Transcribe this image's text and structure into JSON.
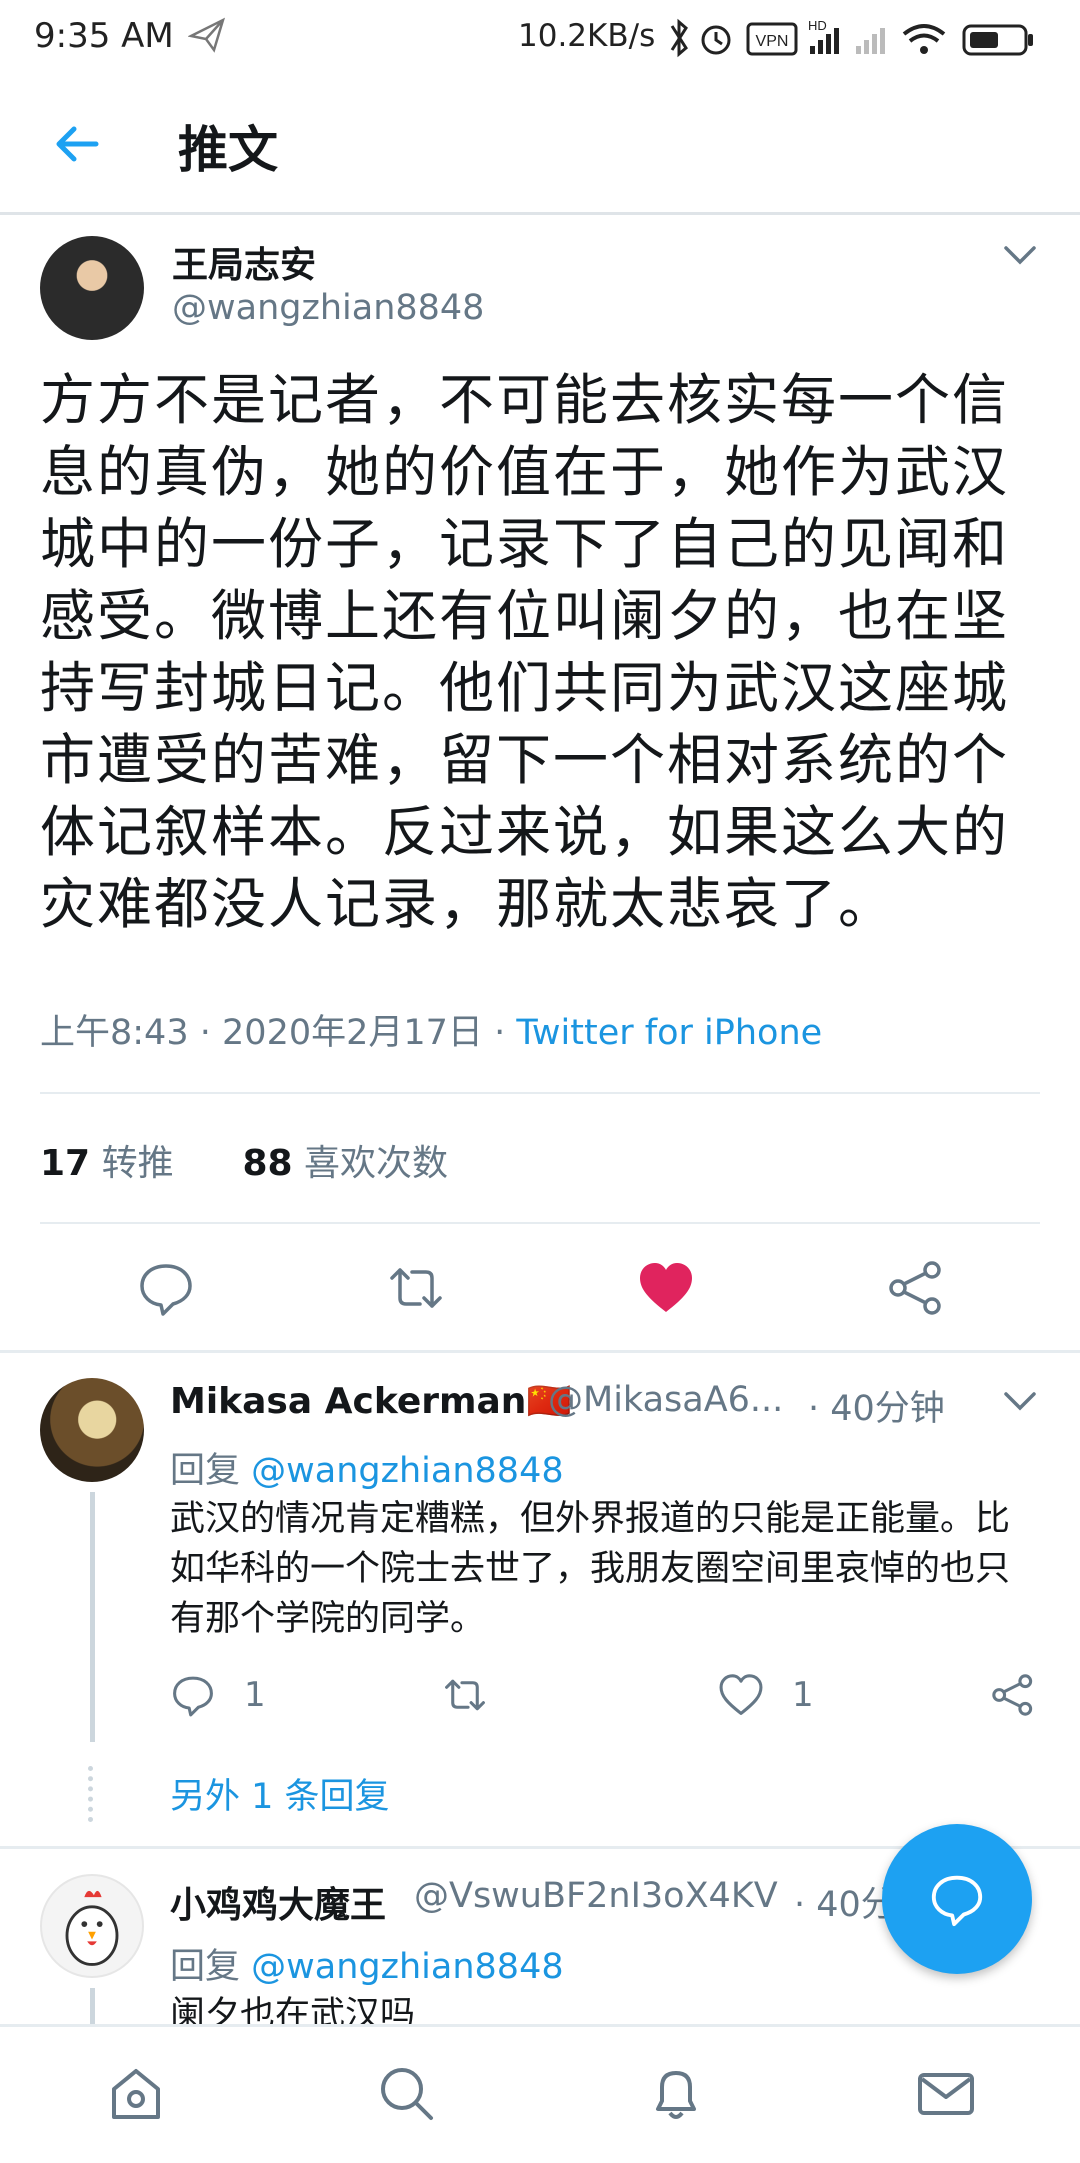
{
  "status_bar": {
    "time": "9:35 AM",
    "speed": "10.2KB/s",
    "icons": [
      "send-icon",
      "bluetooth-icon",
      "alarm-icon",
      "vpn-icon",
      "signal-icon",
      "wifi-icon",
      "battery-icon"
    ],
    "vpn_label": "VPN",
    "hd_label": "HD"
  },
  "header": {
    "title": "推文"
  },
  "tweet": {
    "author_name": "王局志安",
    "author_handle": "@wangzhian8848",
    "text": "方方不是记者，不可能去核实每一个信息的真伪，她的价值在于，她作为武汉城中的一份子，记录下了自己的见闻和感受。微博上还有位叫阑夕的，也在坚持写封城日记。他们共同为武汉这座城市遭受的苦难，留下一个相对系统的个体记叙样本。反过来说，如果这么大的灾难都没人记录，那就太悲哀了。",
    "time": "上午8:43",
    "date": "2020年2月17日",
    "separator": "·",
    "source": "Twitter for iPhone",
    "retweets": "17",
    "retweets_label": "转推",
    "likes": "88",
    "likes_label": "喜欢次数",
    "liked": true
  },
  "replies": [
    {
      "name": "Mikasa Ackerman",
      "flag": "🇨🇳",
      "handle": "@MikasaA6...",
      "time": "· 40分钟",
      "reply_prefix": "回复",
      "reply_to": "@wangzhian8848",
      "text": "武汉的情况肯定糟糕，但外界报道的只能是正能量。比如华科的一个院士去世了，我朋友圈空间里哀悼的也只有那个学院的同学。",
      "reply_count": "1",
      "like_count": "1",
      "more": "另外 1 条回复"
    },
    {
      "name": "小鸡鸡大魔王",
      "handle": "@VswuBF2nI3oX4KV",
      "time": "· 40分",
      "reply_prefix": "回复",
      "reply_to": "@wangzhian8848",
      "text": "阑夕也在武汉吗"
    }
  ],
  "colors": {
    "accent": "#1da1f2",
    "link": "#1b95e0",
    "like": "#e0245e",
    "secondary_text": "#657786"
  },
  "bottom_nav": [
    "home-icon",
    "search-icon",
    "notifications-icon",
    "messages-icon"
  ]
}
